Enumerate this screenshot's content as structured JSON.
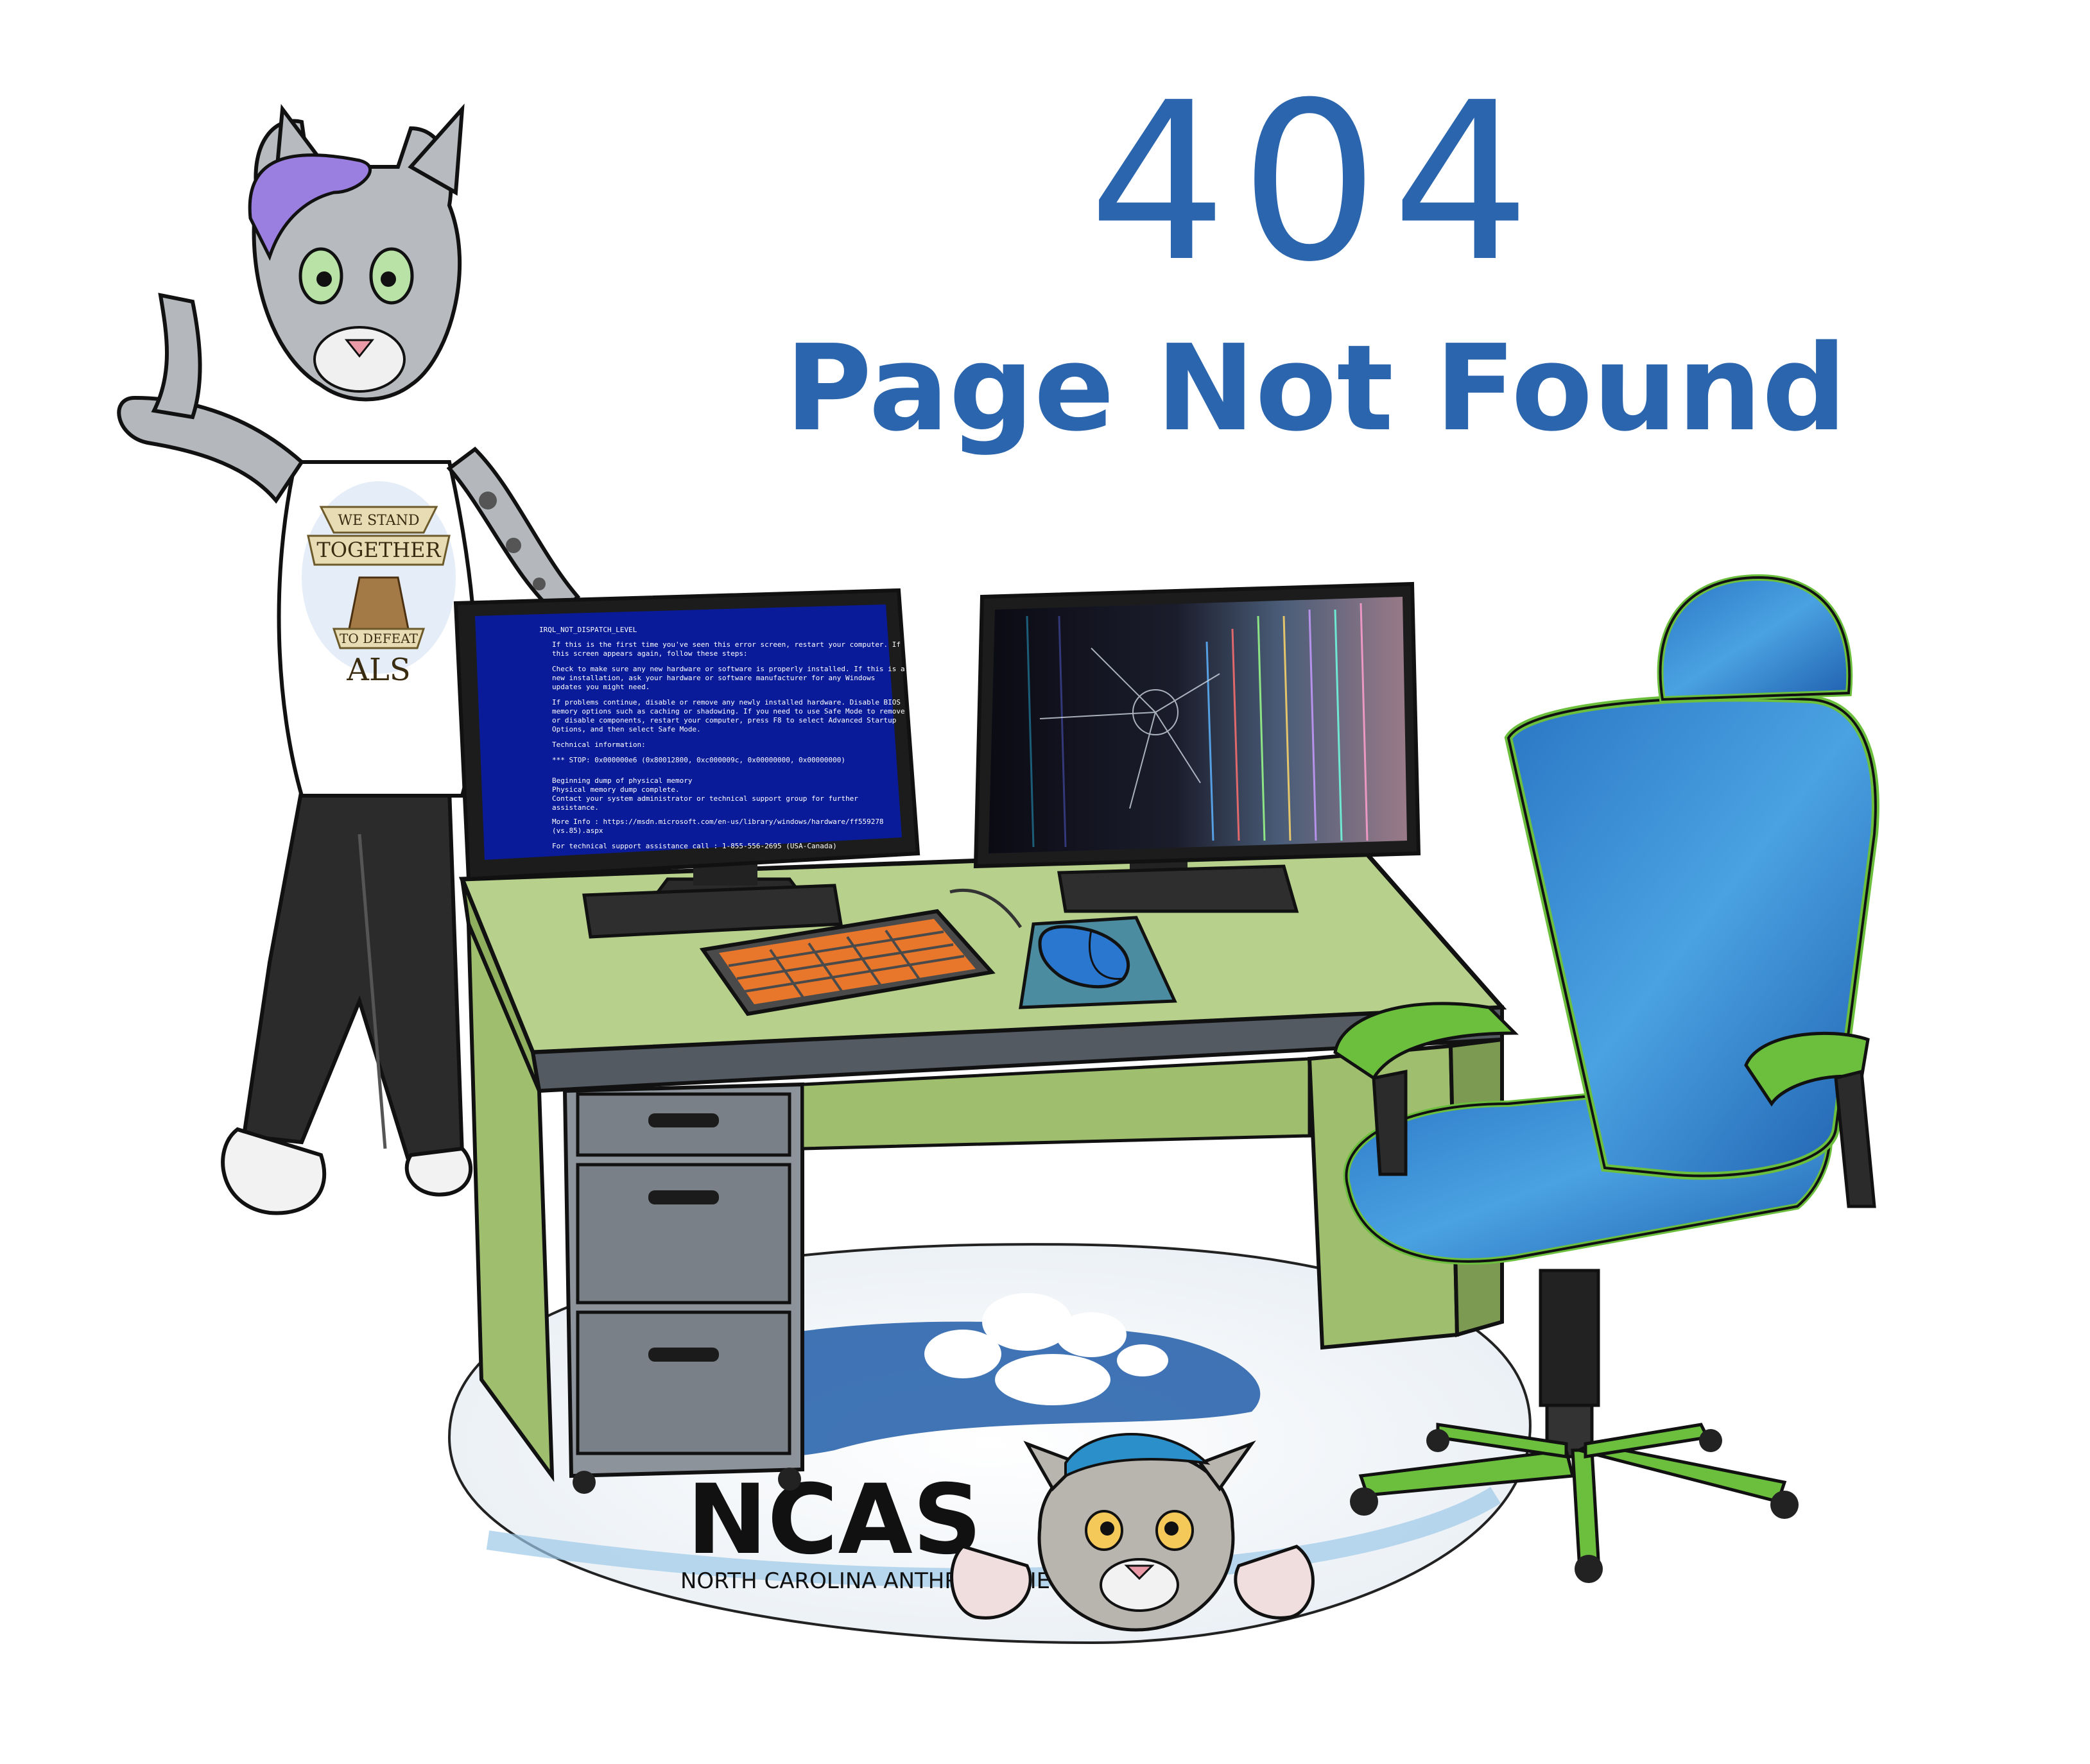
{
  "error": {
    "code": "404",
    "message": "Page Not Found"
  },
  "shirt": {
    "line1": "WE STAND",
    "line2": "TOGETHER",
    "line3": "TO DEFEAT",
    "line4": "ALS"
  },
  "bsod": {
    "lines": [
      "IRQL_NOT_DISPATCH_LEVEL",
      "If this is the first time you've seen this error screen, restart your computer. If",
      "this screen appears again, follow these steps:",
      "Check to make sure any new hardware or software is properly installed. If this is a",
      "new installation, ask your hardware or software manufacturer for any Windows",
      "updates you might need.",
      "If problems continue, disable or remove any newly installed hardware. Disable BIOS",
      "memory options such as caching or shadowing. If you need to use Safe Mode to remove",
      "or disable components, restart your computer, press F8 to select Advanced Startup",
      "Options, and then select Safe Mode.",
      "Technical information:",
      "*** STOP: 0x000000e6 (0x80012800, 0xc000009c, 0x00000000, 0x00000000)",
      "Beginning dump of physical memory",
      "Physical memory dump complete.",
      "Contact your system administrator or technical support group for further",
      "assistance.",
      "More Info : https://msdn.microsoft.com/en-us/library/windows/hardware/ff559278",
      "(vs.85).aspx",
      "For technical support assistance call : 1-855-556-2695 (USA-Canada)"
    ]
  },
  "rug": {
    "logo": "NCAS",
    "tagline": "NORTH CAROLINA ANTHRO SOCIETY"
  },
  "colors": {
    "headline": "#2a65ad",
    "desk_top": "#b7d18d",
    "desk_body": "#9fbf6e",
    "drawer": "#8d939b",
    "chair_seat": "#2f86cf",
    "chair_trim": "#6cbf3c",
    "bsod": "#0a1b9a",
    "keyboard_keys": "#e8772b"
  }
}
